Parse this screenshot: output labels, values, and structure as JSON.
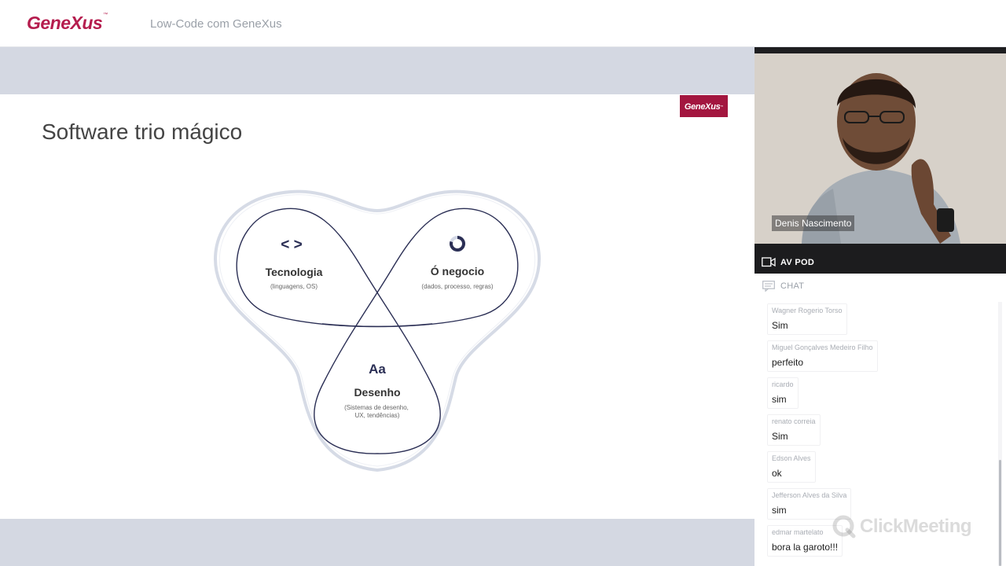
{
  "header": {
    "brand": "GeneXus",
    "trademark": "™",
    "title": "Low-Code com GeneXus"
  },
  "slide": {
    "heading": "Software trio mágico",
    "logo": "GeneXus",
    "logo_tm": "™",
    "petals": [
      {
        "glyph": "< >",
        "title": "Tecnologia",
        "subtitle": "(linguagens, OS)"
      },
      {
        "glyph": "",
        "title": "Ó negocio",
        "subtitle": "(dados, processo, regras)"
      },
      {
        "glyph": "Aa",
        "title": "Desenho",
        "subtitle_line1": "(Sistemas de desenho,",
        "subtitle_line2": "UX, tendências)"
      }
    ]
  },
  "video": {
    "speaker_name": "Denis Nascimento"
  },
  "panel": {
    "av_label": "AV POD",
    "chat_label": "CHAT"
  },
  "chat": {
    "messages": [
      {
        "author": "Wagner Rogerio Torso",
        "text": "Sim"
      },
      {
        "author": "Miguel Gonçalves Medeiro Filho",
        "text": "perfeito"
      },
      {
        "author": "ricardo",
        "text": "sim"
      },
      {
        "author": "renato correia",
        "text": "Sim"
      },
      {
        "author": "Edson Alves",
        "text": "ok"
      },
      {
        "author": "Jefferson Alves da Silva",
        "text": "sim"
      },
      {
        "author": "edmar martelato",
        "text": "bora la garoto!!!"
      }
    ]
  },
  "watermark": "ClickMeeting",
  "colors": {
    "brand": "#b51d4e",
    "slide_logo_bg": "#a3163f",
    "diagram_stroke": "#2b2f55"
  }
}
